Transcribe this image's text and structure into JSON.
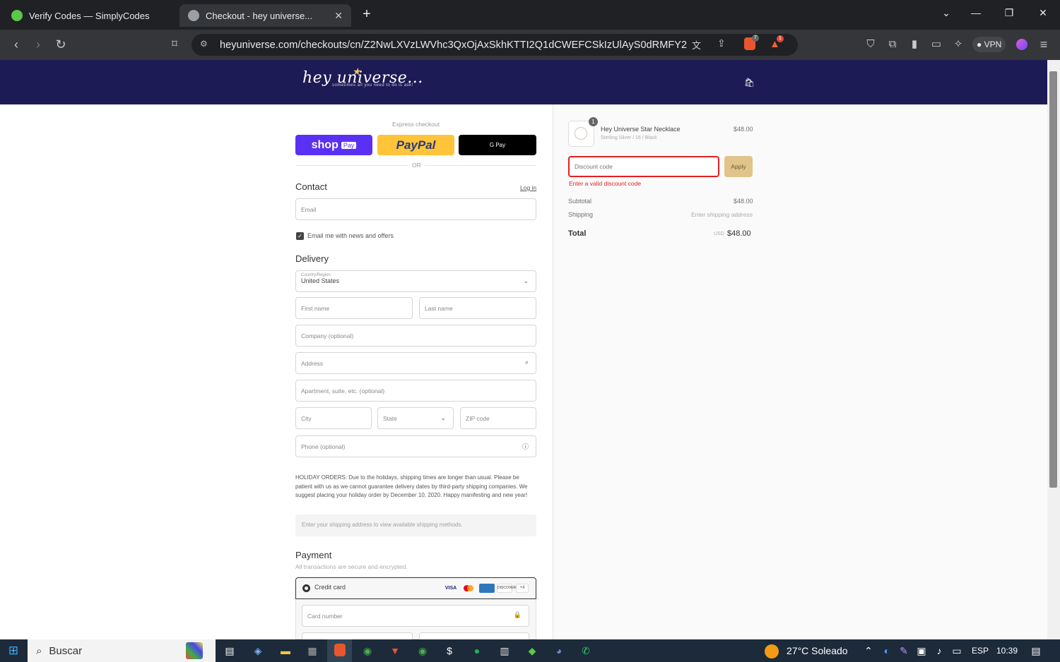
{
  "browser": {
    "tabs": [
      {
        "title": "Verify Codes — SimplyCodes",
        "active": false
      },
      {
        "title": "Checkout - hey universe...",
        "active": true
      }
    ],
    "url": "heyuniverse.com/checkouts/cn/Z2NwLXVzLWVhc3QxOjAxSkhKTTI2Q1dCWEFCSkIzUlAyS0dRMFY2",
    "vpn_label": "VPN",
    "brave_badge": "7",
    "alert_badge": "1"
  },
  "store": {
    "logo_text": "hey universe...",
    "logo_tagline": "sometimes all you need to do is ask!"
  },
  "express": {
    "label": "Express checkout",
    "shop_label": "shop",
    "shop_pay": "Pay",
    "paypal_label": "PayPal",
    "gpay_label": "G Pay",
    "or_label": "OR"
  },
  "contact": {
    "title": "Contact",
    "login_link": "Log in",
    "email_placeholder": "Email",
    "news_checkbox": "Email me with news and offers"
  },
  "delivery": {
    "title": "Delivery",
    "country_label": "Country/Region",
    "country_value": "United States",
    "first_name": "First name",
    "last_name": "Last name",
    "company": "Company (optional)",
    "address": "Address",
    "apartment": "Apartment, suite, etc. (optional)",
    "city": "City",
    "state": "State",
    "zip": "ZIP code",
    "phone": "Phone (optional)",
    "holiday_note": "HOLIDAY ORDERS: Due to the holidays, shipping times are longer than usual. Please be patient with us as we cannot guarantee delivery dates by third-party shipping companies. We suggest placing your holiday order by December 10, 2020. Happy manifesting and new year!",
    "shipping_methods_note": "Enter your shipping address to view available shipping methods."
  },
  "payment": {
    "title": "Payment",
    "subtitle": "All transactions are secure and encrypted.",
    "method_label": "Credit card",
    "more_cards": "+4",
    "card_number": "Card number"
  },
  "summary": {
    "item_name": "Hey Universe Star Necklace",
    "item_variant": "Sterling Silver / 16 / Black",
    "item_price": "$48.00",
    "item_qty": "1",
    "discount_placeholder": "Discount code",
    "apply_label": "Apply",
    "discount_error": "Enter a valid discount code",
    "subtotal_label": "Subtotal",
    "subtotal_value": "$48.00",
    "shipping_label": "Shipping",
    "shipping_value": "Enter shipping address",
    "total_label": "Total",
    "currency": "USD",
    "total_value": "$48.00"
  },
  "taskbar": {
    "search_label": "Buscar",
    "weather": "27°C  Soleado",
    "lang": "ESP",
    "time": "10:39"
  },
  "colors": {
    "header_bg": "#1d1b55",
    "shop_pay": "#5a31f4",
    "paypal": "#ffc439",
    "error": "#e22120",
    "apply_bg": "#e0c48a"
  }
}
